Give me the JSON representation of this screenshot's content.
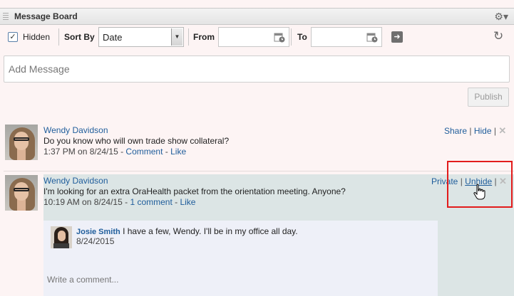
{
  "header": {
    "title": "Message Board",
    "gear_icon": "gear-icon"
  },
  "filters": {
    "hidden_label": "Hidden",
    "hidden_checked": true,
    "sort_by_label": "Sort By",
    "sort_value": "Date",
    "from_label": "From",
    "from_value": "",
    "to_label": "To",
    "to_value": ""
  },
  "composer": {
    "placeholder": "Add Message",
    "publish_label": "Publish"
  },
  "messages": [
    {
      "author": "Wendy Davidson",
      "text": "Do you know who will own trade show collateral?",
      "time": "1:37 PM on 8/24/15",
      "comment_link": "Comment",
      "like_link": "Like",
      "actions": [
        "Share",
        "Hide"
      ],
      "hidden": false
    },
    {
      "author": "Wendy Davidson",
      "text": "I'm looking for an extra OraHealth packet from the orientation meeting. Anyone?",
      "time": "10:19 AM on 8/24/15",
      "comment_link": "1 comment",
      "like_link": "Like",
      "actions": [
        "Private",
        "Unhide"
      ],
      "hidden": true,
      "comments": [
        {
          "author": "Josie Smith",
          "text": "I have a few, Wendy. I'll be in my office all day.",
          "date": "8/24/2015"
        }
      ],
      "comment_placeholder": "Write a comment..."
    }
  ],
  "colors": {
    "link": "#1f5d9b",
    "highlight": "#e21b1b",
    "hidden_bg": "#dce5e5"
  }
}
